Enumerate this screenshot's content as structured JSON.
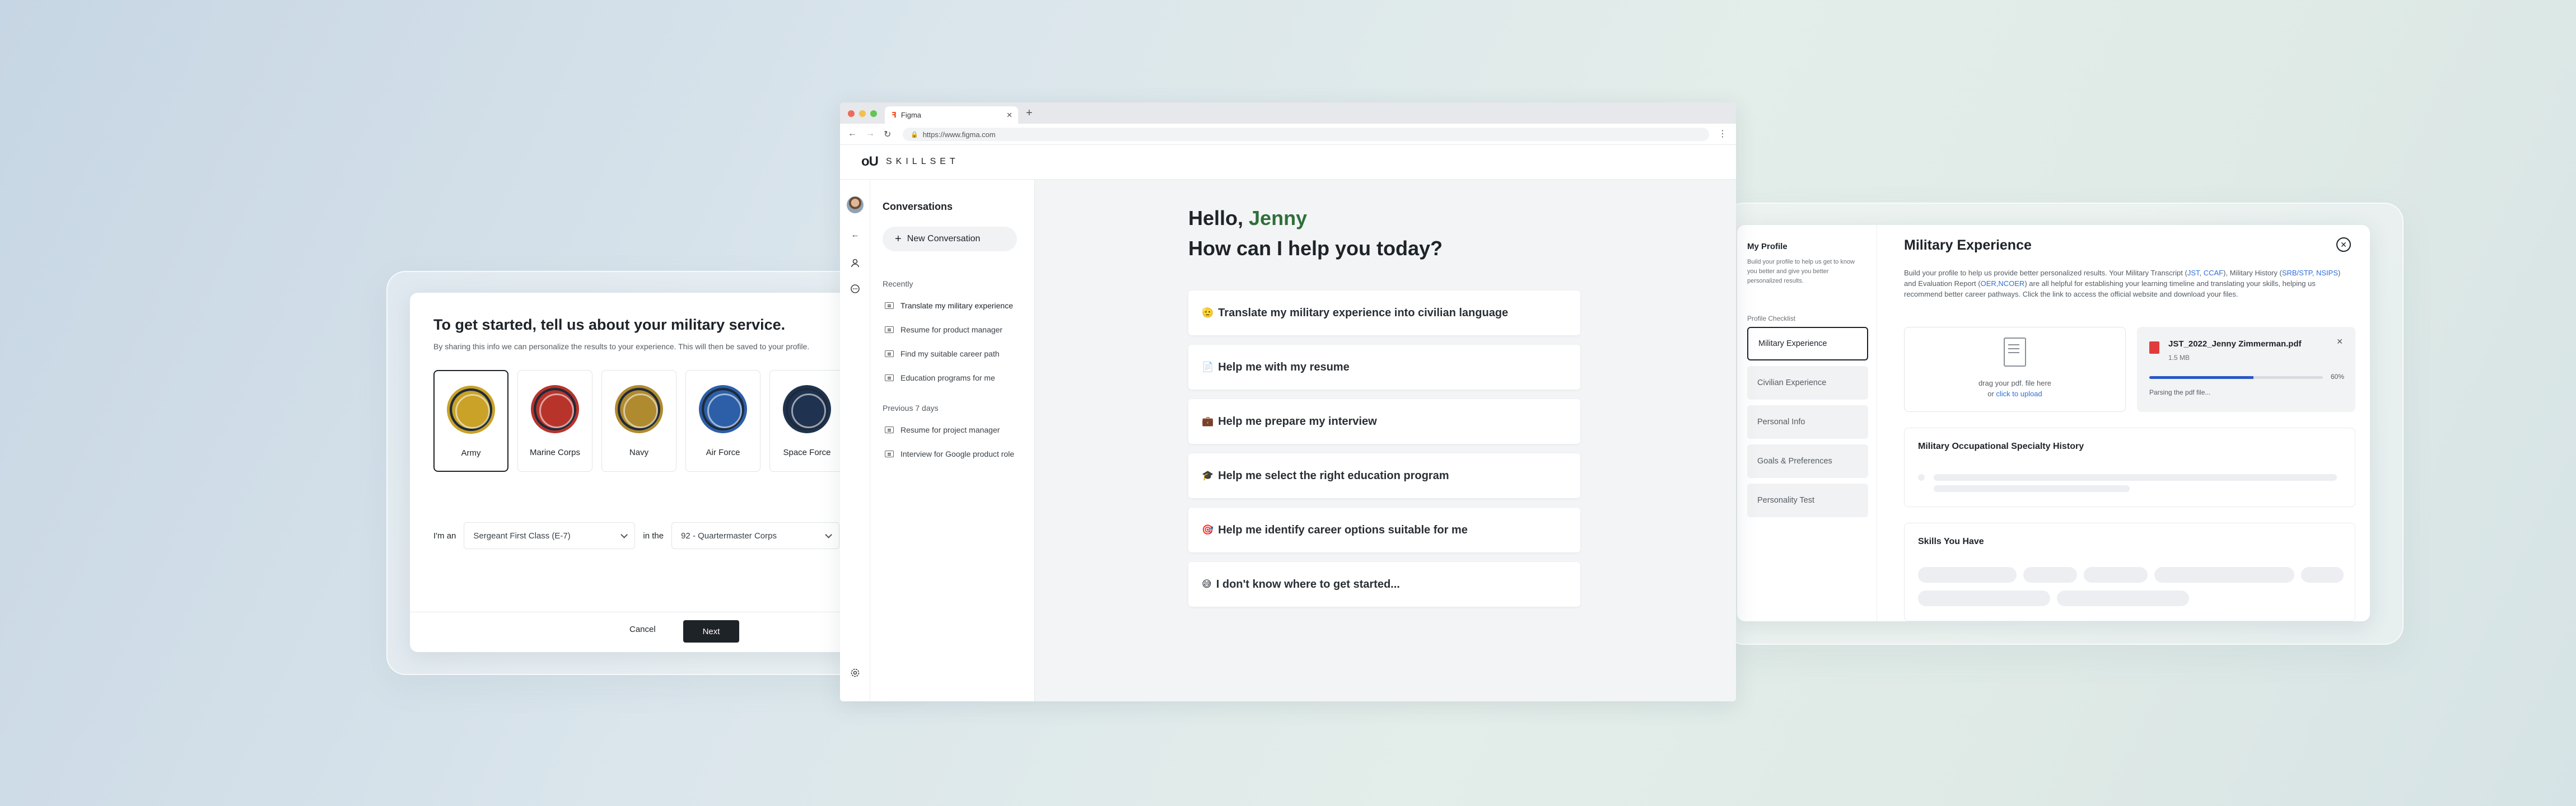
{
  "left_panel": {
    "title": "To get started, tell us about your military service.",
    "subtitle": "By sharing this info we can personalize the results to your experience. This will then be saved to your profile.",
    "branches": [
      {
        "label": "Army",
        "selected": true,
        "color": "#c9a227"
      },
      {
        "label": "Marine Corps",
        "selected": false,
        "color": "#b8342b"
      },
      {
        "label": "Navy",
        "selected": false,
        "color": "#b08a2e"
      },
      {
        "label": "Air Force",
        "selected": false,
        "color": "#2c5fa8"
      },
      {
        "label": "Space Force",
        "selected": false,
        "color": "#1f3350"
      }
    ],
    "rank_prefix": "I'm an",
    "rank_value": "Sergeant First Class (E-7)",
    "corps_prefix": "in the",
    "corps_value": "92 - Quartermaster Corps",
    "cancel_label": "Cancel",
    "next_label": "Next"
  },
  "browser": {
    "tab_title": "Figma",
    "url": "https://www.figma.com",
    "dot_colors": [
      "#ed6a5e",
      "#f5bf4f",
      "#61c554"
    ]
  },
  "app": {
    "logo_mark": "oU",
    "logo_word": "SKILLSET",
    "conversations": {
      "title": "Conversations",
      "new_label": "New Conversation",
      "recent_label": "Recently",
      "recent": [
        "Translate my military experience",
        "Resume for product manager",
        "Find my suitable career path",
        "Education programs for me"
      ],
      "previous_label": "Previous 7 days",
      "previous": [
        "Resume for project manager",
        "Interview for Google product role"
      ]
    },
    "greeting_prefix": "Hello, ",
    "user_name": "Jenny",
    "headline": "How can I help you today?",
    "prompts": [
      {
        "emoji": "🫡",
        "text": "Translate my military experience into civilian language"
      },
      {
        "emoji": "📄",
        "text": "Help me with my resume"
      },
      {
        "emoji": "💼",
        "text": "Help me prepare my interview"
      },
      {
        "emoji": "🎓",
        "text": "Help me select the right education program"
      },
      {
        "emoji": "🎯",
        "text": "Help me identify career options suitable for me"
      },
      {
        "emoji": "😅",
        "text": "I don't know where to get started..."
      }
    ],
    "accent_color": "#2f6f3a"
  },
  "right_panel": {
    "sidebar_title": "My Profile",
    "sidebar_desc": "Build your profile to help us get to know you better and give you better personalized results.",
    "checklist_label": "Profile Checklist",
    "checklist": [
      {
        "label": "Military Experience",
        "active": true
      },
      {
        "label": "Civilian Experience",
        "active": false
      },
      {
        "label": "Personal Info",
        "active": false
      },
      {
        "label": "Goals & Preferences",
        "active": false
      },
      {
        "label": "Personality Test",
        "active": false
      }
    ],
    "title": "Military Experience",
    "desc_1": "Build your profile to help us provide better personalized results. Your Military Transcript (",
    "link_jst": "JST",
    "desc_2": ", ",
    "link_ccaf": "CCAF",
    "desc_3": "), Military History (",
    "link_srb": "SRB/STP, NSIPS",
    "desc_4": ") and Evaluation Report (",
    "link_oer": "OER,NCOER",
    "desc_5": ") are all helpful for establishing your learning timeline and translating your skills, helping us recommend better career pathways. Click the link to access the official website and download your files.",
    "upload_text": "drag  your pdf. file here",
    "upload_or": "or ",
    "upload_link": "click to upload",
    "file_name": "JST_2022_Jenny Zimmerman.pdf",
    "file_size": "1.5 MB",
    "progress_percent": 60,
    "progress_label": "60%",
    "parsing_text": "Parsing the pdf file...",
    "section_mos": "Military Occupational Specialty History",
    "section_skills": "Skills You Have"
  }
}
